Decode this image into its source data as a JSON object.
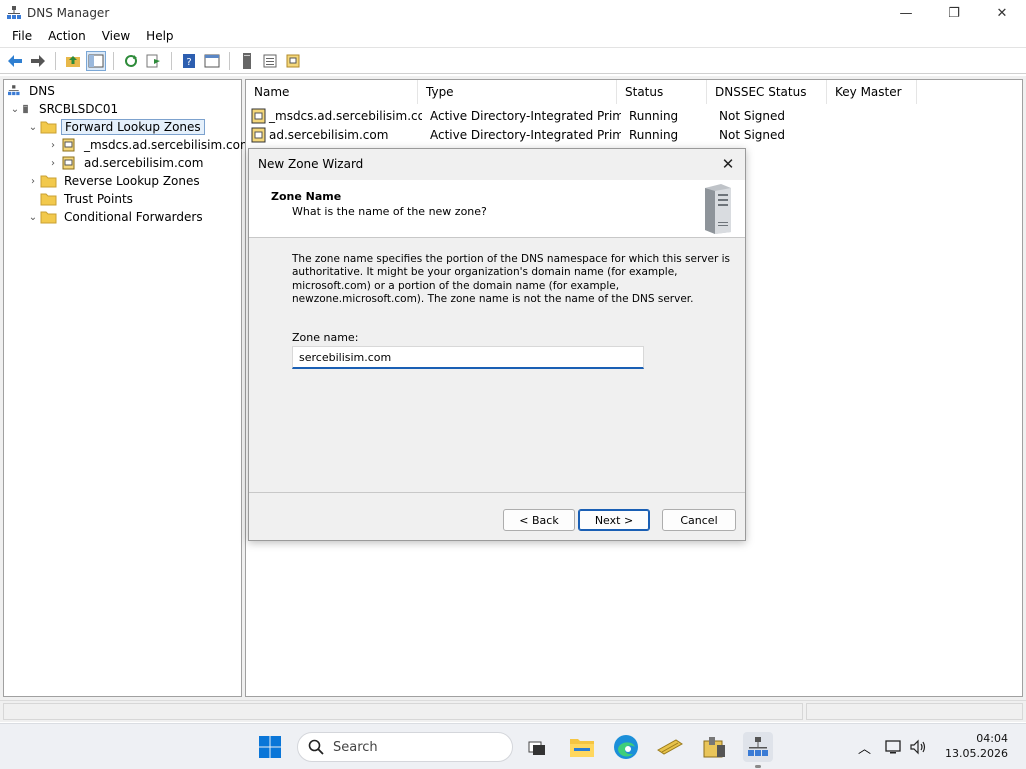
{
  "window": {
    "title": "DNS Manager"
  },
  "menu": [
    "File",
    "Action",
    "View",
    "Help"
  ],
  "tree": {
    "root": "DNS",
    "server": "SRCBLSDC01",
    "forward": "Forward Lookup Zones",
    "zone1": "_msdcs.ad.sercebilisim.com",
    "zone2": "ad.sercebilisim.com",
    "reverse": "Reverse Lookup Zones",
    "trust": "Trust Points",
    "conditional": "Conditional Forwarders"
  },
  "list": {
    "columns": [
      "Name",
      "Type",
      "Status",
      "DNSSEC Status",
      "Key Master"
    ],
    "rows": [
      {
        "name": "_msdcs.ad.sercebilisim.com",
        "type": "Active Directory-Integrated Primary",
        "status": "Running",
        "dnssec": "Not Signed",
        "keymaster": ""
      },
      {
        "name": "ad.sercebilisim.com",
        "type": "Active Directory-Integrated Primary",
        "status": "Running",
        "dnssec": "Not Signed",
        "keymaster": ""
      }
    ]
  },
  "dialog": {
    "title": "New Zone Wizard",
    "header_title": "Zone Name",
    "header_subtitle": "What is the name of the new zone?",
    "description": "The zone name specifies the portion of the DNS namespace for which this server is authoritative. It might be your organization's domain name (for example,  microsoft.com) or a portion of the domain name (for example, newzone.microsoft.com). The zone name is not the name of the DNS server.",
    "zone_label": "Zone name:",
    "zone_value": "sercebilisim.com",
    "back": "< Back",
    "next": "Next >",
    "cancel": "Cancel"
  },
  "taskbar": {
    "search_placeholder": "Search",
    "time": "04:04",
    "date": "13.05.2026"
  },
  "colors": {
    "accent": "#1a5fb4",
    "folder": "#f2c94c",
    "selection": "#e5f0fb"
  }
}
